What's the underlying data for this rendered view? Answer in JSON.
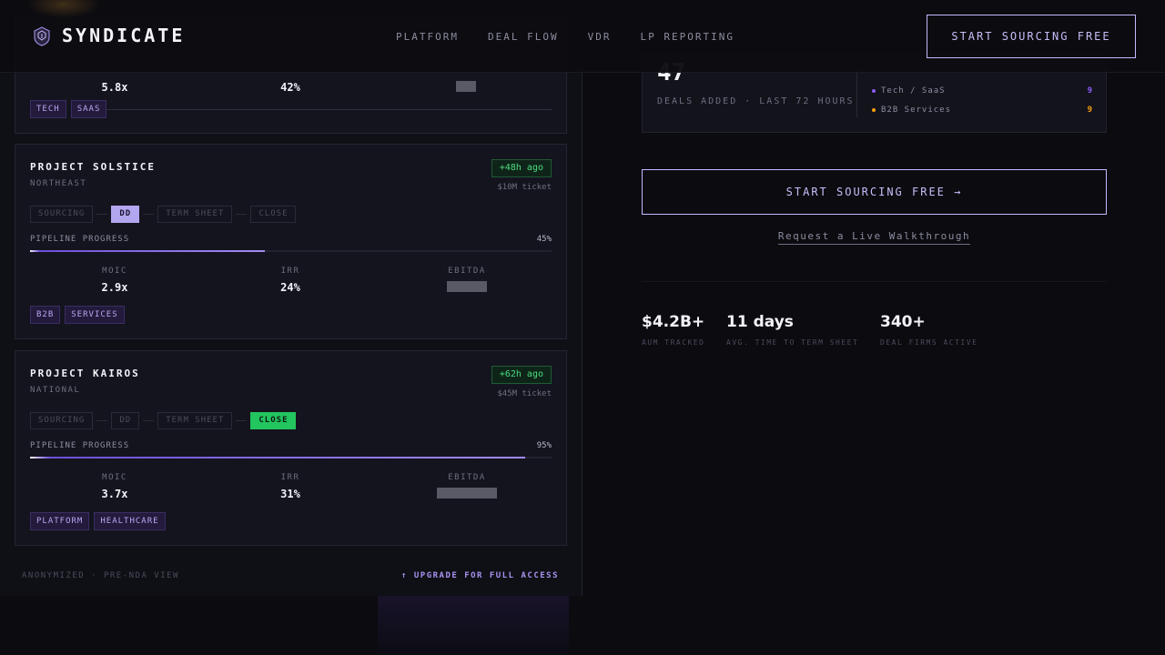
{
  "header": {
    "brand": "SYNDICATE",
    "nav": [
      "PLATFORM",
      "DEAL FLOW",
      "VDR",
      "LP REPORTING"
    ],
    "cta": "START SOURCING FREE"
  },
  "top_card": {
    "moic": "5.8x",
    "irr": "42%",
    "ebitda": "███",
    "tags": [
      "TECH",
      "SAAS"
    ]
  },
  "deals": [
    {
      "title": "PROJECT SOLSTICE",
      "region": "NORTHEAST",
      "age": "+48h ago",
      "ticket": "$10M ticket",
      "stages": [
        "SOURCING",
        "DD",
        "TERM SHEET",
        "CLOSE"
      ],
      "active_stage": 1,
      "progress_label": "PIPELINE PROGRESS",
      "progress_text": "45%",
      "progress": 0.45,
      "metric_labels": [
        "MOIC",
        "IRR",
        "EBITDA"
      ],
      "moic": "2.9x",
      "irr": "24%",
      "ebitda": "██████",
      "tags": [
        "B2B",
        "SERVICES"
      ]
    },
    {
      "title": "PROJECT KAIROS",
      "region": "NATIONAL",
      "age": "+62h ago",
      "ticket": "$45M ticket",
      "stages": [
        "SOURCING",
        "DD",
        "TERM SHEET",
        "CLOSE"
      ],
      "active_stage": 3,
      "progress_label": "PIPELINE PROGRESS",
      "progress_text": "95%",
      "progress": 0.95,
      "metric_labels": [
        "MOIC",
        "IRR",
        "EBITDA"
      ],
      "moic": "3.7x",
      "irr": "31%",
      "ebitda": "█████████",
      "tags": [
        "PLATFORM",
        "HEALTHCARE"
      ]
    }
  ],
  "left_footer": {
    "note": "ANONYMIZED · PRE-NDA VIEW",
    "upgrade": "↑ UPGRADE FOR FULL ACCESS"
  },
  "stats": {
    "big_number": "47",
    "big_label": "DEALS ADDED · LAST 72 HOURS",
    "sectors": [
      {
        "name": "Tech / SaaS",
        "count": "9",
        "color": "#8b5cf6"
      },
      {
        "name": "B2B Services",
        "count": "9",
        "color": "#f59e0b"
      }
    ]
  },
  "cta_main": "START SOURCING FREE →",
  "walkthrough": "Request a Live Walkthrough",
  "kpis": [
    {
      "value": "$4.2B+",
      "label": "AUM TRACKED"
    },
    {
      "value": "11 days",
      "label": "AVG. TIME TO TERM SHEET"
    },
    {
      "value": "340+",
      "label": "DEAL FIRMS ACTIVE"
    }
  ]
}
